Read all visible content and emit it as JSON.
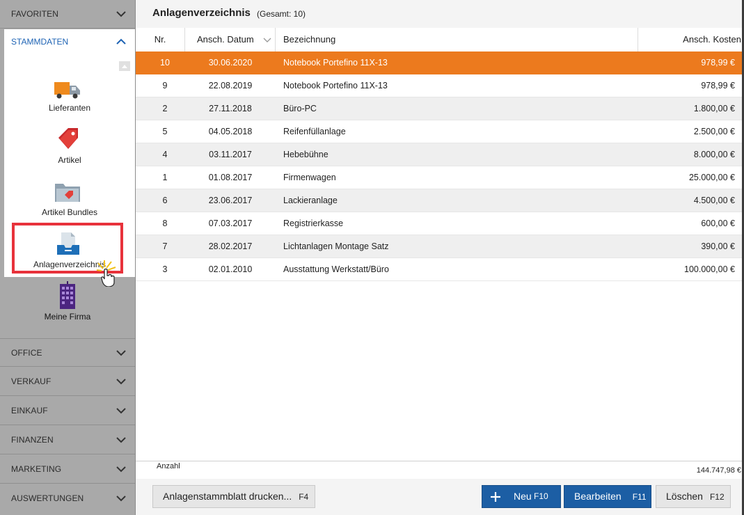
{
  "sidebar": {
    "favoriten": "FAVORITEN",
    "stammdaten": "STAMMDATEN",
    "tiles": {
      "lieferanten": "Lieferanten",
      "artikel": "Artikel",
      "artikel_bundles": "Artikel Bundles",
      "anlagenverzeichnis": "Anlagenverzeichnis",
      "meine_firma": "Meine Firma"
    },
    "categories": [
      "OFFICE",
      "VERKAUF",
      "EINKAUF",
      "FINANZEN",
      "MARKETING",
      "AUSWERTUNGEN"
    ]
  },
  "header": {
    "title": "Anlagenverzeichnis",
    "count": "(Gesamt: 10)"
  },
  "table": {
    "columns": {
      "nr": "Nr.",
      "datum": "Ansch. Datum",
      "bezeichnung": "Bezeichnung",
      "kosten": "Ansch. Kosten"
    },
    "rows": [
      {
        "nr": "10",
        "datum": "30.06.2020",
        "bezeichnung": "Notebook Portefino 11X-13",
        "kosten": "978,99 €"
      },
      {
        "nr": "9",
        "datum": "22.08.2019",
        "bezeichnung": "Notebook Portefino 11X-13",
        "kosten": "978,99 €"
      },
      {
        "nr": "2",
        "datum": "27.11.2018",
        "bezeichnung": "Büro-PC",
        "kosten": "1.800,00 €"
      },
      {
        "nr": "5",
        "datum": "04.05.2018",
        "bezeichnung": "Reifenfüllanlage",
        "kosten": "2.500,00 €"
      },
      {
        "nr": "4",
        "datum": "03.11.2017",
        "bezeichnung": "Hebebühne",
        "kosten": "8.000,00 €"
      },
      {
        "nr": "1",
        "datum": "01.08.2017",
        "bezeichnung": "Firmenwagen",
        "kosten": "25.000,00 €"
      },
      {
        "nr": "6",
        "datum": "23.06.2017",
        "bezeichnung": "Lackieranlage",
        "kosten": "4.500,00 €"
      },
      {
        "nr": "8",
        "datum": "07.03.2017",
        "bezeichnung": "Registrierkasse",
        "kosten": "600,00 €"
      },
      {
        "nr": "7",
        "datum": "28.02.2017",
        "bezeichnung": "Lichtanlagen Montage Satz",
        "kosten": "390,00 €"
      },
      {
        "nr": "3",
        "datum": "02.01.2010",
        "bezeichnung": "Ausstattung Werkstatt/Büro",
        "kosten": "100.000,00 €"
      }
    ],
    "selected_index": 0
  },
  "footer": {
    "anzahl_label": "Anzahl",
    "total": "144.747,98 €"
  },
  "toolbar": {
    "print_label": "Anlagenstammblatt  drucken...",
    "print_key": "F4",
    "new_label": "Neu",
    "new_key": "F10",
    "edit_label": "Bearbeiten",
    "edit_key": "F11",
    "delete_label": "Löschen",
    "delete_key": "F12"
  },
  "colors": {
    "selection": "#ec7a1e",
    "accent_blue": "#1c5ea4",
    "highlight_red": "#e8323b"
  }
}
